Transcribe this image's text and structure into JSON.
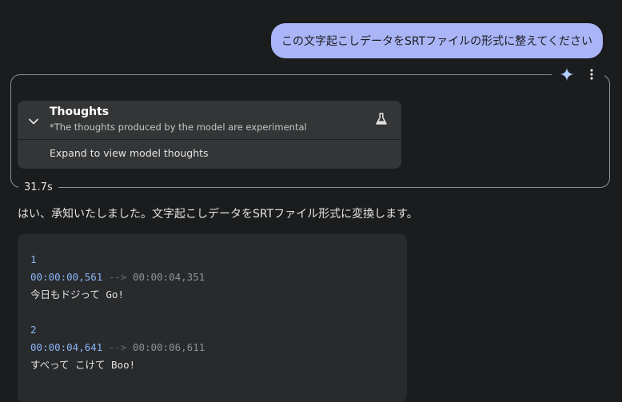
{
  "user_message": "この文字起こしデータをSRTファイルの形式に整えてください",
  "thoughts": {
    "title": "Thoughts",
    "subtitle": "*The thoughts produced by the model are experimental",
    "expand_label": "Expand to view model thoughts"
  },
  "elapsed": "31.7s",
  "reply": "はい、承知いたしました。文字起こしデータをSRTファイル形式に変換します。",
  "code": {
    "entries": [
      {
        "index": "1",
        "start": "00:00:00,561",
        "arrow": "-->",
        "end": "00:00:04,351",
        "text": "今日もドジって Go!"
      },
      {
        "index": "2",
        "start": "00:00:04,641",
        "arrow": "-->",
        "end": "00:00:06,611",
        "text": "すべって こけて Boo!"
      }
    ]
  },
  "icons": {
    "sparkle": "sparkle-icon",
    "more": "more-vert-icon",
    "chevron": "chevron-down-icon",
    "flask": "flask-icon"
  },
  "colors": {
    "background": "#1b1c1d",
    "user_bubble": "#aab5f8",
    "card": "#333537",
    "code_bg": "#282a2c",
    "code_number": "#8ab4f8"
  }
}
